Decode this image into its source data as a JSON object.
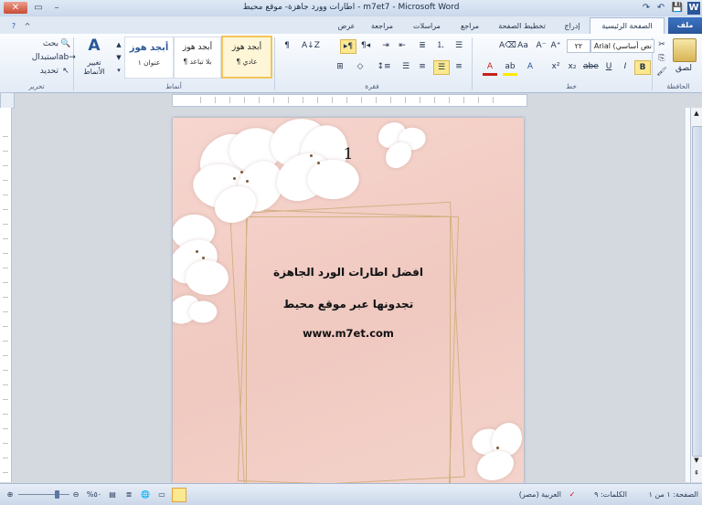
{
  "window": {
    "title": "اطارات وورد جاهزة- موقع محيط - m7et7 - Microsoft Word",
    "close": "✕",
    "maximize": "▭",
    "minimize": "–"
  },
  "qat": {
    "word_icon": "W",
    "save_icon": "💾",
    "undo_icon": "↶",
    "redo_icon": "↷"
  },
  "tabs": {
    "file": "ملف",
    "home": "الصفحة الرئيسية",
    "insert": "إدراج",
    "page_layout": "تخطيط الصفحة",
    "references": "مراجع",
    "mailings": "مراسلات",
    "review": "مراجعة",
    "view": "عرض"
  },
  "ribbon": {
    "clipboard": {
      "paste": "لصق",
      "label": "الحافظة"
    },
    "font": {
      "name": "Arial (نص أساسي",
      "size": "٢٢",
      "label": "خط"
    },
    "paragraph": {
      "label": "فقرة"
    },
    "styles": {
      "normal_title": "أبجد هوز",
      "normal_sub": "¶ عادي",
      "nospacing_title": "أبجد هوز",
      "nospacing_sub": "¶ بلا تباعد",
      "heading1_title": "أبجد هوز",
      "heading1_sub": "عنوان ١",
      "change_styles": "تغيير الأنماط",
      "label": "أنماط"
    },
    "editing": {
      "find": "بحث",
      "replace": "استبدال",
      "select": "تحديد",
      "label": "تحرير"
    }
  },
  "document": {
    "page_number": "1",
    "line1": "افضل اطارات الورد الجاهزة",
    "line2": "تجدونها عبر موقع محيط",
    "url": "www.m7et.com"
  },
  "status": {
    "page": "الصفحة: ١ من ١",
    "words": "الكلمات: ٩",
    "language": "العربية (مصر)",
    "zoom": "%٥٠"
  }
}
